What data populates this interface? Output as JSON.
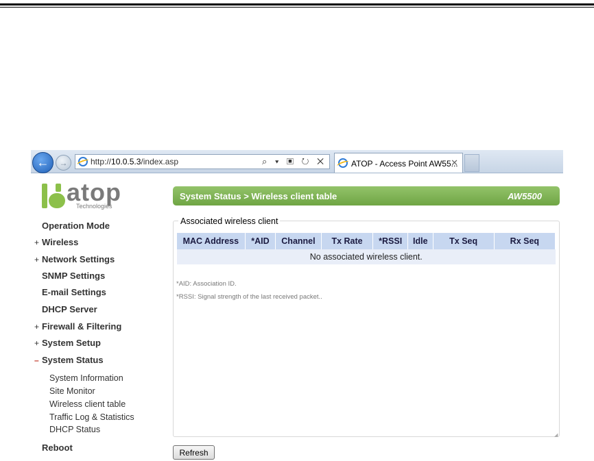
{
  "browser": {
    "url_prefix": "http://",
    "url_host": "10.0.5.3",
    "url_path": "/index.asp",
    "tab_title": "ATOP - Access Point AW55...",
    "tab_close": "✕",
    "addr_tools": "⌕ ▾ ▣ ↻ ✕"
  },
  "logo": {
    "word": "atop",
    "sub": "Technologies",
    "colors": {
      "mark": "#8cc04a",
      "text": "#7a7a7a"
    }
  },
  "sidebar": {
    "items": [
      {
        "prefix": "",
        "label": "Operation Mode"
      },
      {
        "prefix": "+",
        "label": "Wireless"
      },
      {
        "prefix": "+",
        "label": "Network Settings"
      },
      {
        "prefix": "",
        "label": "SNMP Settings"
      },
      {
        "prefix": "",
        "label": "E-mail Settings"
      },
      {
        "prefix": "",
        "label": "DHCP Server"
      },
      {
        "prefix": "+",
        "label": "Firewall & Filtering"
      },
      {
        "prefix": "+",
        "label": "System Setup"
      },
      {
        "prefix": "–",
        "label": "System Status"
      },
      {
        "prefix": "",
        "label": "Reboot"
      }
    ],
    "subitems": [
      {
        "label": "System Information"
      },
      {
        "label": "Site Monitor"
      },
      {
        "label": "Wireless client table"
      },
      {
        "label": "Traffic Log & Statistics"
      },
      {
        "label": "DHCP Status"
      }
    ]
  },
  "header": {
    "breadcrumb": "System Status > Wireless client table",
    "model": "AW5500",
    "colors": {
      "bar": "#7cb150"
    }
  },
  "panel": {
    "legend": "Associated wireless client",
    "columns": [
      "MAC Address",
      "*AID",
      "Channel",
      "Tx Rate",
      "*RSSI",
      "Idle",
      "Tx Seq",
      "Rx Seq"
    ],
    "empty_message": "No associated wireless client.",
    "notes": [
      "*AID: Association ID.",
      "*RSSI: Signal strength of the last received packet.."
    ]
  },
  "actions": {
    "refresh_label": "Refresh"
  }
}
